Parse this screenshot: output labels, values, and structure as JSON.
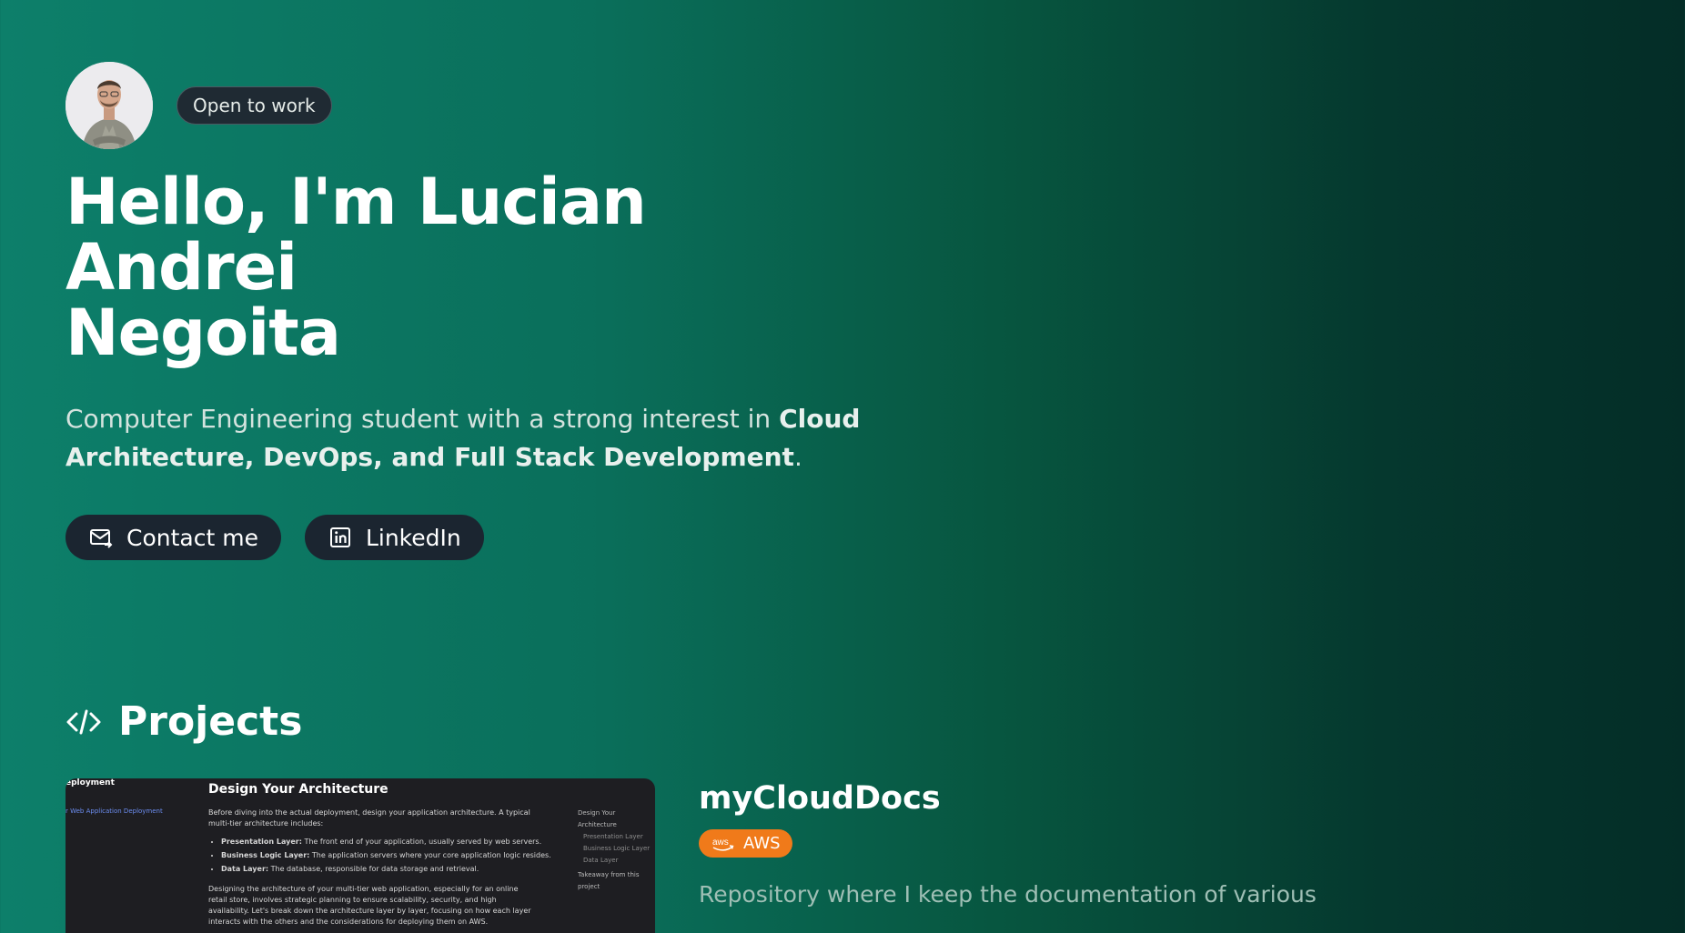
{
  "hero": {
    "badge": "Open to work",
    "title_line1": "Hello, I'm Lucian Andrei",
    "title_line2": "Negoita",
    "subtitle_prefix": "Computer Engineering student with a strong interest in ",
    "subtitle_bold": "Cloud Architecture, DevOps, and Full Stack Development",
    "subtitle_suffix": ".",
    "contact_label": "Contact me",
    "linkedin_label": "LinkedIn"
  },
  "projects": {
    "heading": "Projects",
    "items": [
      {
        "title": "myCloudDocs",
        "tag": "AWS",
        "tag_logo": "aws",
        "description": "Repository where I keep the documentation of various",
        "thumb": {
          "corner_label": "eployment",
          "heading": "Design Your Architecture",
          "sidebar_link": "r Web Application Deployment",
          "intro": "Before diving into the actual deployment, design your application architecture. A typical multi-tier architecture includes:",
          "bullets": [
            {
              "bold": "Presentation Layer:",
              "text": " The front end of your application, usually served by web servers."
            },
            {
              "bold": "Business Logic Layer:",
              "text": " The application servers where your core application logic resides."
            },
            {
              "bold": "Data Layer:",
              "text": " The database, responsible for data storage and retrieval."
            }
          ],
          "paragraph": "Designing the architecture of your multi-tier web application, especially for an online retail store, involves strategic planning to ensure scalability, security, and high availability. Let's break down the architecture layer by layer, focusing on how each layer interacts with the others and the considerations for deploying them on AWS.",
          "toc": [
            "Design Your Architecture",
            "Presentation Layer",
            "Business Logic Layer",
            "Data Layer",
            "Takeaway from this project"
          ]
        }
      }
    ]
  },
  "colors": {
    "accent_green": "#0d7f6a",
    "button_bg": "#1b2530",
    "aws_orange": "#f07a1a"
  },
  "icons": [
    "mail-icon",
    "linkedin-icon",
    "code-icon",
    "aws-logo"
  ]
}
